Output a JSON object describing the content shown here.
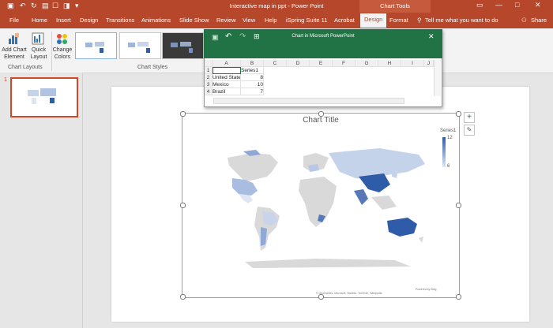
{
  "window": {
    "title": "Interactive map in ppt - Power Point",
    "chart_tools": "Chart Tools",
    "min": "—",
    "max": "□",
    "close": "✕",
    "autosave_icon": "save-icon",
    "undo_icon": "undo-icon",
    "redo_icon": "redo-icon"
  },
  "tabs": [
    "File",
    "Home",
    "Insert",
    "Design",
    "Transitions",
    "Animations",
    "Slide Show",
    "Review",
    "View",
    "Help",
    "iSpring Suite 11",
    "Acrobat",
    "Design",
    "Format"
  ],
  "active_tab_index": 12,
  "tell_me": "Tell me what you want to do",
  "share": "Share",
  "ribbon": {
    "add_chart_element": [
      "Add Chart",
      "Element"
    ],
    "quick_layout": [
      "Quick",
      "Layout"
    ],
    "change_colors": [
      "Change",
      "Colors"
    ],
    "group_chart_layouts": "Chart Layouts",
    "group_chart_styles": "Chart Styles"
  },
  "slide_panel": {
    "slide_number": "1"
  },
  "sheet": {
    "title": "Chart in Microsoft PowerPoint",
    "columns": [
      "A",
      "B",
      "C",
      "D",
      "E",
      "F",
      "G",
      "H",
      "I",
      "J"
    ],
    "rows": [
      [
        "",
        "Series1"
      ],
      [
        "United States",
        "8"
      ],
      [
        "Mexico",
        "10"
      ],
      [
        "Brazil",
        "7"
      ]
    ],
    "row_numbers": [
      "1",
      "2",
      "3",
      "4"
    ]
  },
  "chart": {
    "title": "Chart Title",
    "legend_title": "Series1",
    "legend_max": "12",
    "legend_min": "6",
    "footer_powered": "Powered by Bing",
    "footer_credits": "© GeoNames, Microsoft, Navinfo, TomTom, Wikipedia",
    "colors": {
      "low": "#dce6f5",
      "high": "#2e5ca8",
      "land": "#d9d9d9"
    }
  },
  "side_buttons": {
    "elements": "+",
    "styles": "✎"
  }
}
